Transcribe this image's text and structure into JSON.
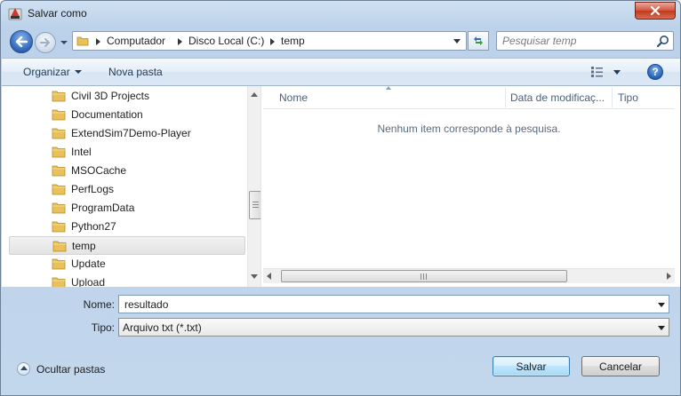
{
  "window": {
    "title": "Salvar como",
    "close_label": "✕"
  },
  "address": {
    "crumbs": [
      "Computador",
      "Disco Local (C:)",
      "temp"
    ]
  },
  "search": {
    "placeholder": "Pesquisar temp"
  },
  "toolbar": {
    "organize_label": "Organizar",
    "new_folder_label": "Nova pasta",
    "help_label": "?"
  },
  "nav_tree": {
    "items": [
      {
        "label": "Civil 3D Projects",
        "selected": false
      },
      {
        "label": "Documentation",
        "selected": false
      },
      {
        "label": "ExtendSim7Demo-Player",
        "selected": false
      },
      {
        "label": "Intel",
        "selected": false
      },
      {
        "label": "MSOCache",
        "selected": false
      },
      {
        "label": "PerfLogs",
        "selected": false
      },
      {
        "label": "ProgramData",
        "selected": false
      },
      {
        "label": "Python27",
        "selected": false
      },
      {
        "label": "temp",
        "selected": true
      },
      {
        "label": "Update",
        "selected": false
      },
      {
        "label": "Upload",
        "selected": false
      }
    ]
  },
  "file_list": {
    "columns": [
      "Nome",
      "Data de modificaç...",
      "Tipo"
    ],
    "empty_message": "Nenhum item corresponde à pesquisa."
  },
  "form": {
    "name_label": "Nome:",
    "name_value": "resultado",
    "type_label": "Tipo:",
    "type_value": "Arquivo txt (*.txt)"
  },
  "footer": {
    "hide_folders_label": "Ocultar pastas",
    "save_label": "Salvar",
    "cancel_label": "Cancelar"
  },
  "colors": {
    "folder": "#e8c15a",
    "accent_blue": "#2c63b8",
    "close_red": "#c0391f"
  }
}
